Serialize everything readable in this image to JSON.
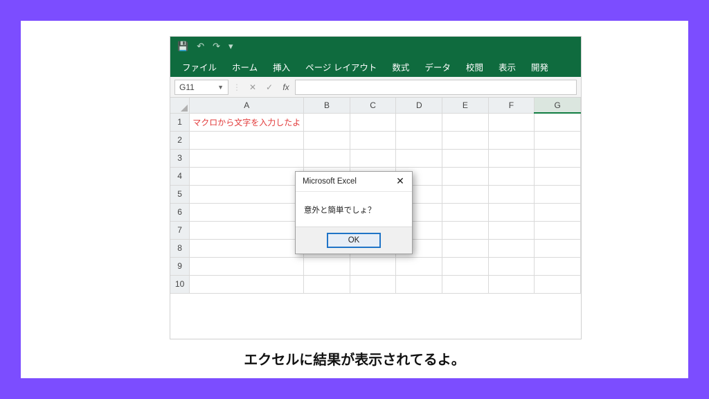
{
  "ribbon": {
    "tabs": [
      "ファイル",
      "ホーム",
      "挿入",
      "ページ レイアウト",
      "数式",
      "データ",
      "校閲",
      "表示",
      "開発"
    ]
  },
  "titlebar": {
    "save_icon": "💾",
    "undo_icon": "↶",
    "redo_icon": "↷",
    "more_icon": "▾"
  },
  "namebox": {
    "value": "G11",
    "cancel": "✕",
    "confirm": "✓",
    "fx": "fx"
  },
  "columns": [
    "A",
    "B",
    "C",
    "D",
    "E",
    "F",
    "G"
  ],
  "rows": [
    "1",
    "2",
    "3",
    "4",
    "5",
    "6",
    "7",
    "8",
    "9",
    "10"
  ],
  "selected_column": "G",
  "cells": {
    "A1": "マクロから文字を入力したよ"
  },
  "msgbox": {
    "title": "Microsoft Excel",
    "body": "意外と簡単でしょ？",
    "ok": "OK",
    "close": "✕"
  },
  "caption": "エクセルに結果が表示されてるよ。"
}
